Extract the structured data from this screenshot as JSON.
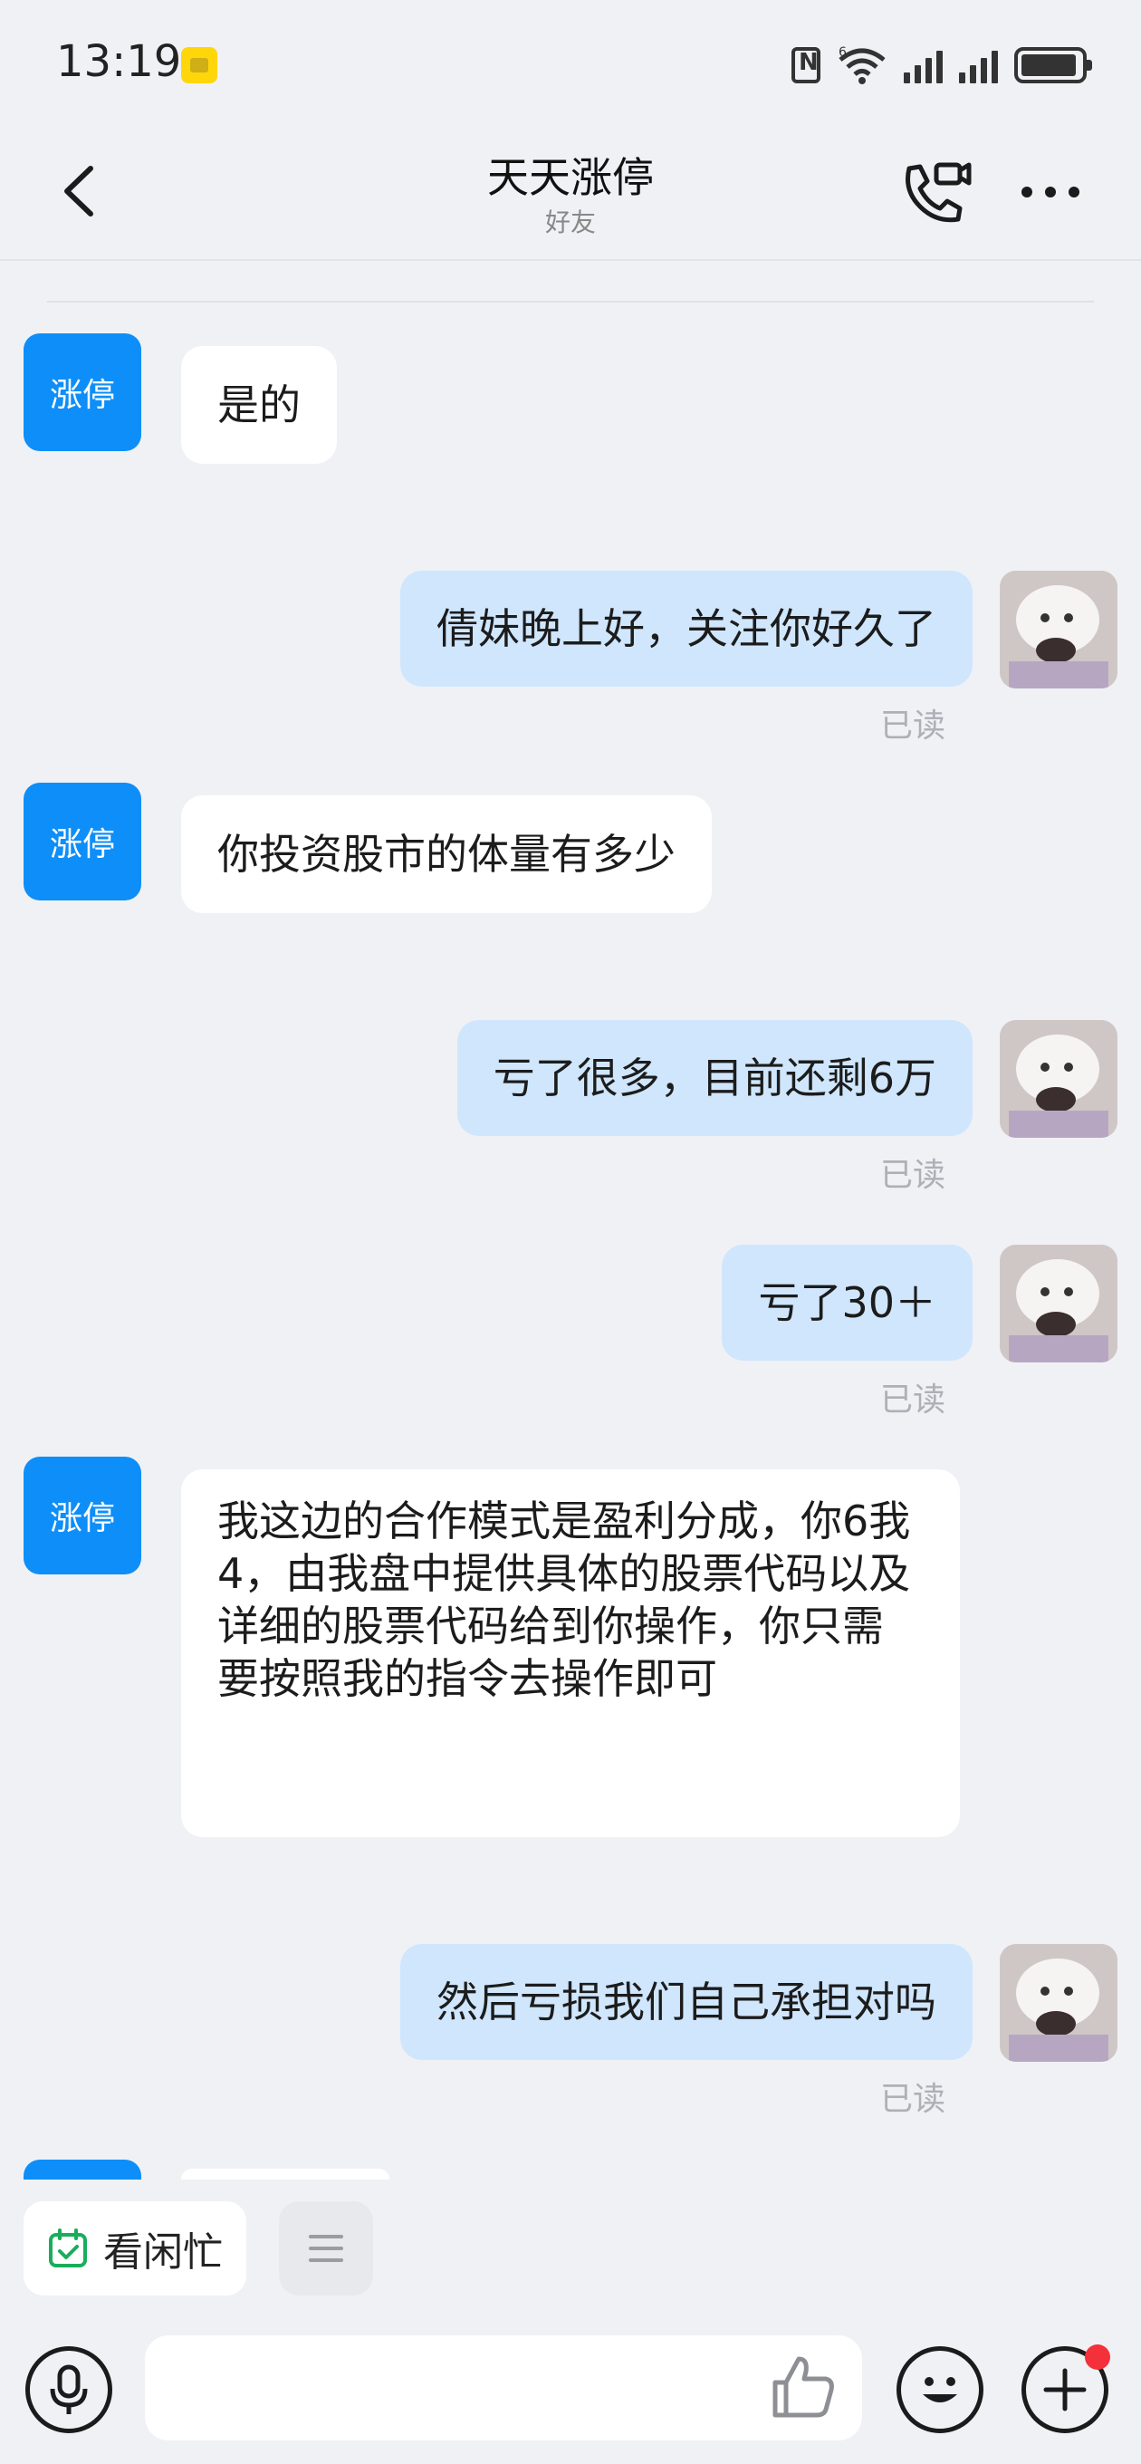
{
  "status_bar": {
    "time": "13:19",
    "network": "6"
  },
  "header": {
    "title": "天天涨停",
    "subtitle": "好友"
  },
  "contact": {
    "avatar_text": "涨停"
  },
  "messages": [
    {
      "from": "them",
      "text": "是的"
    },
    {
      "from": "me",
      "text": "倩妹晚上好，关注你好久了",
      "status": "已读"
    },
    {
      "from": "them",
      "text": "你投资股市的体量有多少"
    },
    {
      "from": "me",
      "text": "亏了很多，目前还剩6万",
      "status": "已读"
    },
    {
      "from": "me",
      "text": "亏了30＋",
      "status": "已读"
    },
    {
      "from": "them",
      "text": "我这边的合作模式是盈利分成，你6我4，由我盘中提供具体的股票代码以及详细的股票代码给到你操作，你只需要按照我的指令去操作即可"
    },
    {
      "from": "me",
      "text": "然后亏损我们自己承担对吗",
      "status": "已读"
    }
  ],
  "quick_actions": {
    "schedule_label": "看闲忙"
  },
  "colors": {
    "accent": "#0e8ef8",
    "my_bubble": "#cfe6fd",
    "notification_dot": "#f4303a"
  }
}
